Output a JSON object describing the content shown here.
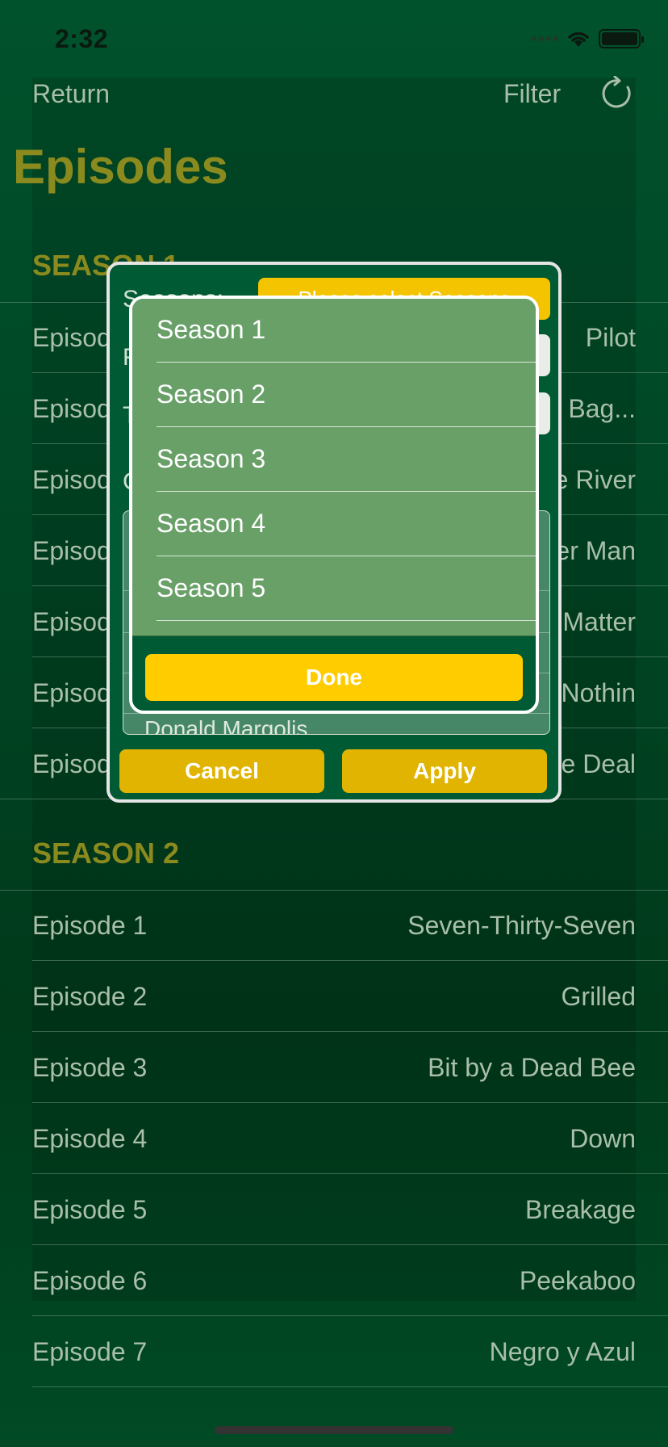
{
  "status_bar": {
    "time": "2:32"
  },
  "nav": {
    "return_label": "Return",
    "filter_label": "Filter"
  },
  "page_title": "Episodes",
  "seasons": [
    {
      "header": "SEASON 1",
      "episodes": [
        {
          "number": "Episod",
          "title": "Pilot"
        },
        {
          "number": "Episod",
          "title": "Bag..."
        },
        {
          "number": "Episod",
          "title": "e River"
        },
        {
          "number": "Episod",
          "title": "er Man"
        },
        {
          "number": "Episod",
          "title": "Matter"
        },
        {
          "number": "Episod",
          "title": "Nothin"
        },
        {
          "number": "Episod",
          "title": "e Deal"
        }
      ]
    },
    {
      "header": "SEASON 2",
      "episodes": [
        {
          "number": "Episode 1",
          "title": "Seven-Thirty-Seven"
        },
        {
          "number": "Episode 2",
          "title": "Grilled"
        },
        {
          "number": "Episode 3",
          "title": "Bit by a Dead Bee"
        },
        {
          "number": "Episode 4",
          "title": "Down"
        },
        {
          "number": "Episode 5",
          "title": "Breakage"
        },
        {
          "number": "Episode 6",
          "title": "Peekaboo"
        },
        {
          "number": "Episode 7",
          "title": "Negro y Azul"
        }
      ]
    }
  ],
  "filter_dialog": {
    "seasons_label": "Seasons:",
    "seasons_button": "Please select Seasons",
    "label_2": "F",
    "label_3": "T",
    "label_4": "C",
    "list_partial_item": "Donald Margolis",
    "cancel_label": "Cancel",
    "apply_label": "Apply"
  },
  "season_picker": {
    "items": [
      "Season 1",
      "Season 2",
      "Season 3",
      "Season 4",
      "Season 5"
    ],
    "done_label": "Done"
  },
  "colors": {
    "background": "#004524",
    "accent_gold": "#8a8a1e",
    "button_yellow": "#ffcc00",
    "picker_green": "#68a068"
  }
}
